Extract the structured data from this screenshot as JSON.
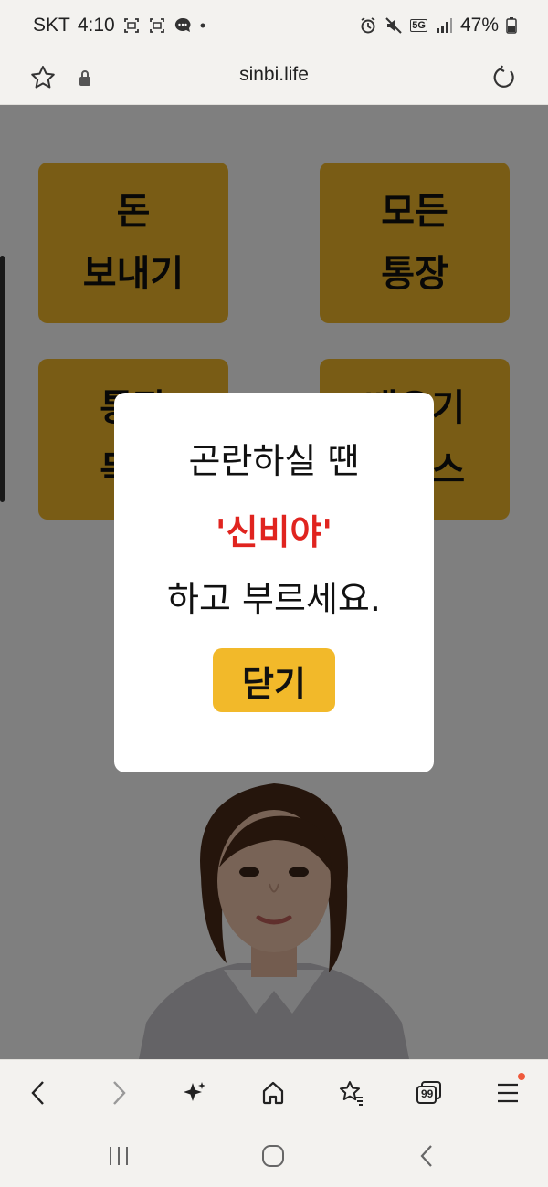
{
  "status_bar": {
    "carrier": "SKT",
    "time": "4:10",
    "network": "5G",
    "battery": "47%",
    "icons": [
      "screenshot-icon",
      "screenshot-icon",
      "message-icon",
      "dot-icon",
      "alarm-icon",
      "mute-icon",
      "network-5g-icon",
      "signal-icon",
      "battery-icon"
    ]
  },
  "address_bar": {
    "url": "sinbi.life",
    "icons": [
      "star-icon",
      "lock-icon",
      "reload-icon"
    ]
  },
  "tiles": [
    {
      "line1": "돈",
      "line2": "보내기"
    },
    {
      "line1": "모든",
      "line2": "통장"
    },
    {
      "line1": "통장",
      "line2": "목록"
    },
    {
      "line1": "배우기",
      "line2": "서비스"
    }
  ],
  "modal": {
    "line1": "곤란하실 땐",
    "highlight": "'신비야'",
    "line3": "하고 부르세요.",
    "close_label": "닫기"
  },
  "colors": {
    "tile_background": "#f2b92a",
    "highlight": "#e0241f",
    "overlay": "rgba(0,0,0,0.5)",
    "tabs_badge": "#ef5a3c"
  },
  "bottom_toolbar": {
    "icons": [
      "back-icon",
      "forward-icon",
      "sparkle-icon",
      "home-icon",
      "bookmarks-icon",
      "tabs-icon",
      "menu-icon"
    ],
    "tabs_count": "99"
  },
  "system_nav": {
    "icons": [
      "recents-icon",
      "home-nav-icon",
      "back-nav-icon"
    ]
  }
}
